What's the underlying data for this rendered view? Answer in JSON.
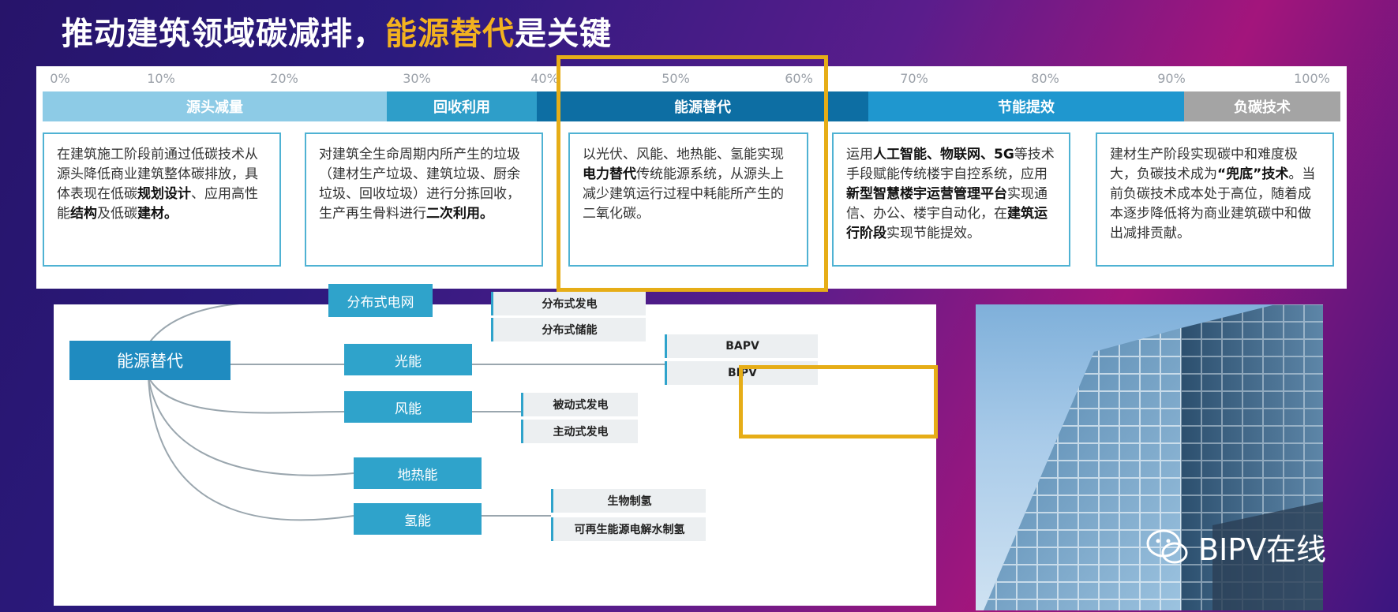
{
  "title": {
    "part1": "推动建筑领域碳减排，",
    "highlight": "能源替代",
    "part2": "是关键"
  },
  "scale": [
    "0%",
    "10%",
    "20%",
    "30%",
    "40%",
    "50%",
    "60%",
    "70%",
    "80%",
    "90%",
    "100%"
  ],
  "bars": [
    {
      "label": "源头减量",
      "color": "#8dcbe6"
    },
    {
      "label": "回收利用",
      "color": "#2e9ec9"
    },
    {
      "label": "能源替代",
      "color": "#0d6ea3"
    },
    {
      "label": "节能提效",
      "color": "#1f97cf"
    },
    {
      "label": "负碳技术",
      "color": "#a4a4a4"
    }
  ],
  "boxes": [
    {
      "segments": [
        {
          "t": "在建筑施工阶段前通过低碳技术从源头降低商业建筑整体碳排放，具体表现在低碳"
        },
        {
          "t": "规划设计",
          "b": true
        },
        {
          "t": "、应用高性能"
        },
        {
          "t": "结构",
          "b": true
        },
        {
          "t": "及低碳"
        },
        {
          "t": "建材。",
          "b": true
        }
      ]
    },
    {
      "segments": [
        {
          "t": "对建筑全生命周期内所产生的垃圾（建材生产垃圾、建筑垃圾、厨余垃圾、回收垃圾）进行分拣回收，生产再生骨料进行"
        },
        {
          "t": "二次利用。",
          "b": true
        }
      ]
    },
    {
      "segments": [
        {
          "t": "以光伏、风能、地热能、氢能实现"
        },
        {
          "t": "电力替代",
          "b": true
        },
        {
          "t": "传统能源系统，从源头上减少建筑运行过程中耗能所产生的二氧化碳。"
        }
      ]
    },
    {
      "segments": [
        {
          "t": "运用"
        },
        {
          "t": "人工智能、物联网、5G",
          "b": true
        },
        {
          "t": "等技术手段赋能传统楼宇自控系统，应用"
        },
        {
          "t": "新型智慧楼宇运营管理平台",
          "b": true
        },
        {
          "t": "实现通信、办公、楼宇自动化，在"
        },
        {
          "t": "建筑运行阶段",
          "b": true
        },
        {
          "t": "实现节能提效。"
        }
      ]
    },
    {
      "segments": [
        {
          "t": "建材生产阶段实现碳中和难度极大，负碳技术成为"
        },
        {
          "t": "“兜底”技术",
          "b": true
        },
        {
          "t": "。当前负碳技术成本处于高位，随着成本逐步降低将为商业建筑碳中和做出减排贡献。"
        }
      ]
    }
  ],
  "mindmap": {
    "root": "能源替代",
    "branches": [
      {
        "label": "分布式电网",
        "leaves": [
          "分布式发电",
          "分布式储能"
        ]
      },
      {
        "label": "光能",
        "leaves": [
          "BAPV",
          "BIPV"
        ]
      },
      {
        "label": "风能",
        "leaves": [
          "被动式发电",
          "主动式发电"
        ]
      },
      {
        "label": "地热能",
        "leaves": []
      },
      {
        "label": "氢能",
        "leaves": [
          "生物制氢",
          "可再生能源电解水制氢"
        ]
      }
    ]
  },
  "watermark": "BIPV在线",
  "colors": {
    "highlight": "#e6ad17",
    "node": "#2fa3cb",
    "root": "#1f8bc0"
  }
}
